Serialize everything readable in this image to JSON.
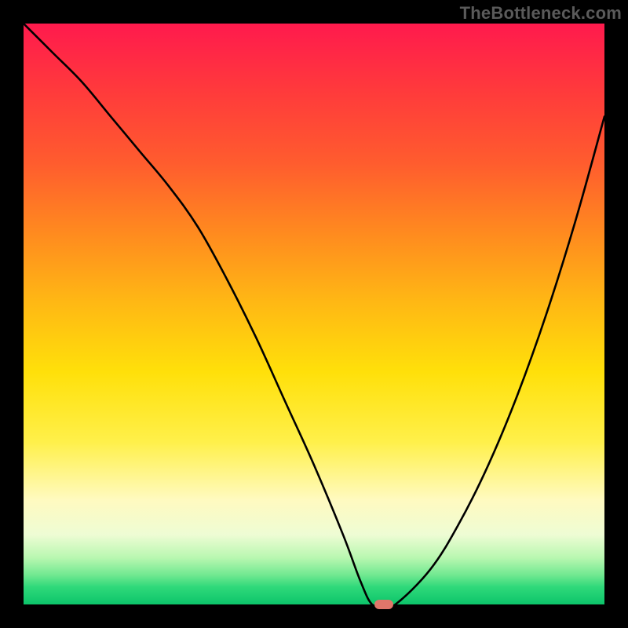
{
  "watermark": "TheBottleneck.com",
  "chart_data": {
    "type": "line",
    "title": "",
    "xlabel": "",
    "ylabel": "",
    "xlim": [
      0,
      100
    ],
    "ylim": [
      0,
      100
    ],
    "x": [
      0,
      5,
      10,
      15,
      20,
      25,
      30,
      35,
      40,
      45,
      50,
      55,
      58,
      60,
      62,
      64,
      70,
      75,
      80,
      85,
      90,
      95,
      100
    ],
    "values": [
      100,
      95,
      90,
      84,
      78,
      72,
      65,
      56,
      46,
      35,
      24,
      12,
      4,
      0,
      0,
      0,
      6,
      14,
      24,
      36,
      50,
      66,
      84
    ],
    "marker": {
      "x": 62,
      "y": 0
    },
    "gradient_stops": [
      {
        "pos": 0,
        "color": "#ff1a4d"
      },
      {
        "pos": 60,
        "color": "#ffe00a"
      },
      {
        "pos": 88,
        "color": "#eefcd4"
      },
      {
        "pos": 100,
        "color": "#0cc46a"
      }
    ]
  }
}
